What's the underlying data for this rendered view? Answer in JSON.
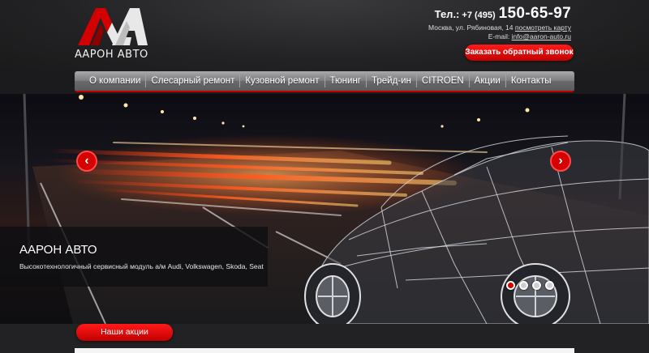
{
  "header": {
    "logo_text": "ААРОН АВТО",
    "phone_label": "Тел.:",
    "phone_code": "+7 (495)",
    "phone_number": "150-65-97",
    "address": "Москва, ул. Рябиновая, 14",
    "map_link": "посмотреть карту",
    "email_label": "E-mail:",
    "email": "info@aaron-auto.ru",
    "callback_label": "Заказать обратный звонок"
  },
  "nav": {
    "items": [
      {
        "label": "О компании"
      },
      {
        "label": "Слесарный ремонт"
      },
      {
        "label": "Кузовной ремонт"
      },
      {
        "label": "Тюнинг"
      },
      {
        "label": "Трейд-ин"
      },
      {
        "label": "CITROEN"
      },
      {
        "label": "Акции"
      },
      {
        "label": "Контакты"
      }
    ]
  },
  "slider": {
    "prev_icon": "chevron-left-icon",
    "next_icon": "chevron-right-icon",
    "prev_glyph": "‹",
    "next_glyph": "›",
    "caption_title": "ААРОН АВТО",
    "caption_text": "Высокотехнологичный сервисный модуль а/м Audi, Volkswagen, Skoda, Seat",
    "slide_count": 4,
    "active_slide": 1
  },
  "promo": {
    "label": "Наши акции"
  },
  "colors": {
    "accent": "#d50000",
    "nav": "#7c7c7e",
    "background": "#1b1b1d"
  }
}
